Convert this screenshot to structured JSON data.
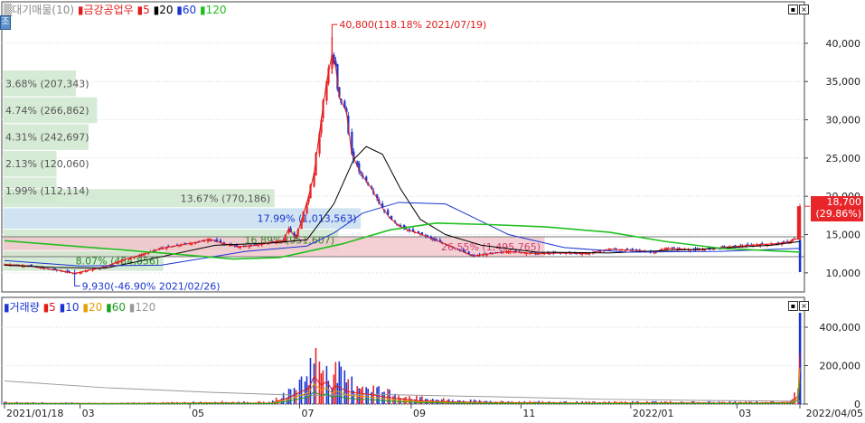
{
  "header_price": {
    "legend_prefix": "▒대기매물(10)",
    "security": "금강공업우",
    "ma": [
      {
        "label": "5",
        "color": "#e01b1b"
      },
      {
        "label": "20",
        "color": "#000000"
      },
      {
        "label": "60",
        "color": "#1a35d0"
      },
      {
        "label": "120",
        "color": "#20c020"
      }
    ]
  },
  "header_volume": {
    "title": "거래량",
    "ma": [
      {
        "label": "5",
        "color": "#e01b1b"
      },
      {
        "label": "10",
        "color": "#1a35d0"
      },
      {
        "label": "20",
        "color": "#e8a000"
      },
      {
        "label": "60",
        "color": "#20a020"
      },
      {
        "label": "120",
        "color": "#999999"
      }
    ]
  },
  "side_tab": "조",
  "chart_data": [
    {
      "type": "candlestick",
      "title": "금강공업우",
      "y_axis_ticks": [
        "40,000",
        "35,000",
        "30,000",
        "25,000",
        "20,000",
        "15,000",
        "10,000"
      ],
      "y_tick_values": [
        40000,
        35000,
        30000,
        25000,
        20000,
        15000,
        10000
      ],
      "ylim": [
        7500,
        44000
      ],
      "x_axis_labels": [
        "2021/01/18",
        "03",
        "05",
        "07",
        "09",
        "11",
        "2022/01",
        "03",
        "2022/04/05"
      ],
      "x_range": [
        "2021/01/18",
        "2022/04/05"
      ],
      "close_series": [
        [
          "2021-01-18",
          11100
        ],
        [
          "2021-01-25",
          11000
        ],
        [
          "2021-02-01",
          10900
        ],
        [
          "2021-02-08",
          10600
        ],
        [
          "2021-02-15",
          10400
        ],
        [
          "2021-02-22",
          10100
        ],
        [
          "2021-02-26",
          9930
        ],
        [
          "2021-03-05",
          10300
        ],
        [
          "2021-03-15",
          10800
        ],
        [
          "2021-03-25",
          11700
        ],
        [
          "2021-04-05",
          12400
        ],
        [
          "2021-04-15",
          13200
        ],
        [
          "2021-04-25",
          13600
        ],
        [
          "2021-05-05",
          14000
        ],
        [
          "2021-05-12",
          14400
        ],
        [
          "2021-05-20",
          13800
        ],
        [
          "2021-05-28",
          13400
        ],
        [
          "2021-06-07",
          13600
        ],
        [
          "2021-06-15",
          14000
        ],
        [
          "2021-06-22",
          14200
        ],
        [
          "2021-06-25",
          15800
        ],
        [
          "2021-06-29",
          14500
        ],
        [
          "2021-07-02",
          16800
        ],
        [
          "2021-07-06",
          20000
        ],
        [
          "2021-07-09",
          23000
        ],
        [
          "2021-07-13",
          30000
        ],
        [
          "2021-07-16",
          35000
        ],
        [
          "2021-07-19",
          38500
        ],
        [
          "2021-07-21",
          37000
        ],
        [
          "2021-07-23",
          33000
        ],
        [
          "2021-07-27",
          31000
        ],
        [
          "2021-07-30",
          25500
        ],
        [
          "2021-08-04",
          23000
        ],
        [
          "2021-08-10",
          21000
        ],
        [
          "2021-08-16",
          18500
        ],
        [
          "2021-08-20",
          17200
        ],
        [
          "2021-08-25",
          16200
        ],
        [
          "2021-08-30",
          15600
        ],
        [
          "2021-09-06",
          15100
        ],
        [
          "2021-09-14",
          14300
        ],
        [
          "2021-09-24",
          13400
        ],
        [
          "2021-10-05",
          12200
        ],
        [
          "2021-10-12",
          12400
        ],
        [
          "2021-10-25",
          12800
        ],
        [
          "2021-11-10",
          12500
        ],
        [
          "2021-11-25",
          12600
        ],
        [
          "2021-12-08",
          12500
        ],
        [
          "2021-12-20",
          13100
        ],
        [
          "2022-01-05",
          12900
        ],
        [
          "2022-01-14",
          12700
        ],
        [
          "2022-01-21",
          13200
        ],
        [
          "2022-02-07",
          13000
        ],
        [
          "2022-02-21",
          13300
        ],
        [
          "2022-03-03",
          13500
        ],
        [
          "2022-03-14",
          13700
        ],
        [
          "2022-03-23",
          13800
        ],
        [
          "2022-03-31",
          14100
        ],
        [
          "2022-04-01",
          14400
        ],
        [
          "2022-04-04",
          14400
        ],
        [
          "2022-04-05",
          18700
        ]
      ],
      "ma_series": [
        {
          "name": "20",
          "color": "#000000",
          "points": [
            [
              "2021-01-18",
              11000
            ],
            [
              "2021-02-15",
              10700
            ],
            [
              "2021-03-15",
              10600
            ],
            [
              "2021-04-15",
              12100
            ],
            [
              "2021-05-15",
              13600
            ],
            [
              "2021-06-15",
              13900
            ],
            [
              "2021-07-05",
              14300
            ],
            [
              "2021-07-20",
              19000
            ],
            [
              "2021-07-31",
              24800
            ],
            [
              "2021-08-07",
              26500
            ],
            [
              "2021-08-16",
              25500
            ],
            [
              "2021-08-26",
              21000
            ],
            [
              "2021-09-06",
              17000
            ],
            [
              "2021-09-20",
              15000
            ],
            [
              "2021-10-10",
              13600
            ],
            [
              "2021-11-10",
              12700
            ],
            [
              "2021-12-20",
              12600
            ],
            [
              "2022-02-10",
              13100
            ],
            [
              "2022-03-20",
              13600
            ],
            [
              "2022-04-05",
              14100
            ]
          ]
        },
        {
          "name": "60",
          "color": "#1a35d0",
          "points": [
            [
              "2021-01-18",
              11600
            ],
            [
              "2021-03-01",
              10900
            ],
            [
              "2021-04-15",
              11000
            ],
            [
              "2021-06-01",
              12800
            ],
            [
              "2021-07-05",
              13500
            ],
            [
              "2021-07-20",
              15200
            ],
            [
              "2021-08-05",
              17800
            ],
            [
              "2021-08-25",
              19200
            ],
            [
              "2021-09-20",
              19000
            ],
            [
              "2021-10-05",
              17300
            ],
            [
              "2021-10-25",
              15000
            ],
            [
              "2021-11-25",
              13300
            ],
            [
              "2021-12-30",
              12700
            ],
            [
              "2022-02-20",
              12800
            ],
            [
              "2022-04-05",
              13200
            ]
          ]
        },
        {
          "name": "120",
          "color": "#20c020",
          "points": [
            [
              "2021-01-18",
              14200
            ],
            [
              "2021-04-15",
              12600
            ],
            [
              "2021-05-25",
              11800
            ],
            [
              "2021-06-20",
              12000
            ],
            [
              "2021-07-25",
              13800
            ],
            [
              "2021-08-20",
              15600
            ],
            [
              "2021-09-15",
              16500
            ],
            [
              "2021-10-15",
              16300
            ],
            [
              "2021-11-15",
              16000
            ],
            [
              "2021-12-20",
              15300
            ],
            [
              "2022-01-20",
              14100
            ],
            [
              "2022-02-20",
              13200
            ],
            [
              "2022-04-05",
              12700
            ]
          ]
        }
      ],
      "annotations": [
        {
          "text": "40,800(118.18% 2021/07/19)",
          "color": "#e01b1b",
          "date": "2021-07-19",
          "value": 40800
        },
        {
          "text": "9,930(-46.90% 2021/02/26)",
          "color": "#1a35d0",
          "date": "2021-02-26",
          "value": 9930
        }
      ],
      "last_price": {
        "value": "18,700",
        "change": "(29.86%)",
        "price": 18700
      },
      "volume_profile": {
        "title": "대기매물(10)",
        "bands": [
          {
            "label": "3.68% (207,343)",
            "low": 33000,
            "high": 36500,
            "share": 0.136
          },
          {
            "label": "4.74% (266,862)",
            "low": 29500,
            "high": 33000,
            "share": 0.175
          },
          {
            "label": "4.31% (242,697)",
            "low": 26000,
            "high": 29500,
            "share": 0.159
          },
          {
            "label": "2.13% (120,060)",
            "low": 22500,
            "high": 26000,
            "share": 0.078
          },
          {
            "label": "1.99% (112,114)",
            "low": 19000,
            "high": 22500,
            "share": 0.073
          },
          {
            "label": "13.67% (770,186)",
            "low": 18500,
            "high": 21000,
            "share": 0.502
          },
          {
            "label": "17.99% (1,013,563)",
            "low": 15700,
            "high": 18500,
            "share": 0.661
          },
          {
            "label": "16.89% (951,607)",
            "low": 12900,
            "high": 15700,
            "share": 0.62
          },
          {
            "label": "26.55% (1,495,765)",
            "low": 12100,
            "high": 14700,
            "share": 1.0
          },
          {
            "label": "8.07% (454,856)",
            "low": 10200,
            "high": 12900,
            "share": 0.297
          }
        ]
      }
    },
    {
      "type": "bar",
      "title": "거래량",
      "y_axis_ticks": [
        "400,000",
        "200,000",
        "0"
      ],
      "y_tick_values": [
        400000,
        200000,
        0
      ],
      "ylim": [
        0,
        480000
      ],
      "series": [
        {
          "name": "거래량",
          "points": [
            [
              "2021-01-18",
              9000
            ],
            [
              "2021-02-15",
              6000
            ],
            [
              "2021-03-15",
              5000
            ],
            [
              "2021-04-15",
              7000
            ],
            [
              "2021-05-12",
              12000
            ],
            [
              "2021-06-15",
              9000
            ],
            [
              "2021-06-25",
              60000
            ],
            [
              "2021-07-06",
              150000
            ],
            [
              "2021-07-09",
              260000
            ],
            [
              "2021-07-13",
              180000
            ],
            [
              "2021-07-16",
              210000
            ],
            [
              "2021-07-19",
              140000
            ],
            [
              "2021-07-21",
              170000
            ],
            [
              "2021-07-23",
              160000
            ],
            [
              "2021-07-27",
              120000
            ],
            [
              "2021-07-30",
              110000
            ],
            [
              "2021-08-04",
              100000
            ],
            [
              "2021-08-10",
              90000
            ],
            [
              "2021-08-16",
              70000
            ],
            [
              "2021-08-25",
              50000
            ],
            [
              "2021-09-06",
              30000
            ],
            [
              "2021-09-24",
              20000
            ],
            [
              "2021-10-12",
              15000
            ],
            [
              "2021-11-10",
              12000
            ],
            [
              "2021-12-08",
              10000
            ],
            [
              "2022-01-14",
              12000
            ],
            [
              "2022-02-21",
              10000
            ],
            [
              "2022-03-14",
              11000
            ],
            [
              "2022-03-31",
              15000
            ],
            [
              "2022-04-01",
              20000
            ],
            [
              "2022-04-04",
              80000
            ],
            [
              "2022-04-05",
              475000
            ]
          ]
        },
        {
          "name": "120",
          "color": "#999999",
          "points": [
            [
              "2021-01-18",
              120000
            ],
            [
              "2021-03-15",
              85000
            ],
            [
              "2021-05-15",
              60000
            ],
            [
              "2021-07-05",
              45000
            ],
            [
              "2021-08-15",
              50000
            ],
            [
              "2021-10-15",
              38000
            ],
            [
              "2021-12-15",
              25000
            ],
            [
              "2022-02-15",
              18000
            ],
            [
              "2022-04-05",
              15000
            ]
          ]
        }
      ]
    }
  ]
}
